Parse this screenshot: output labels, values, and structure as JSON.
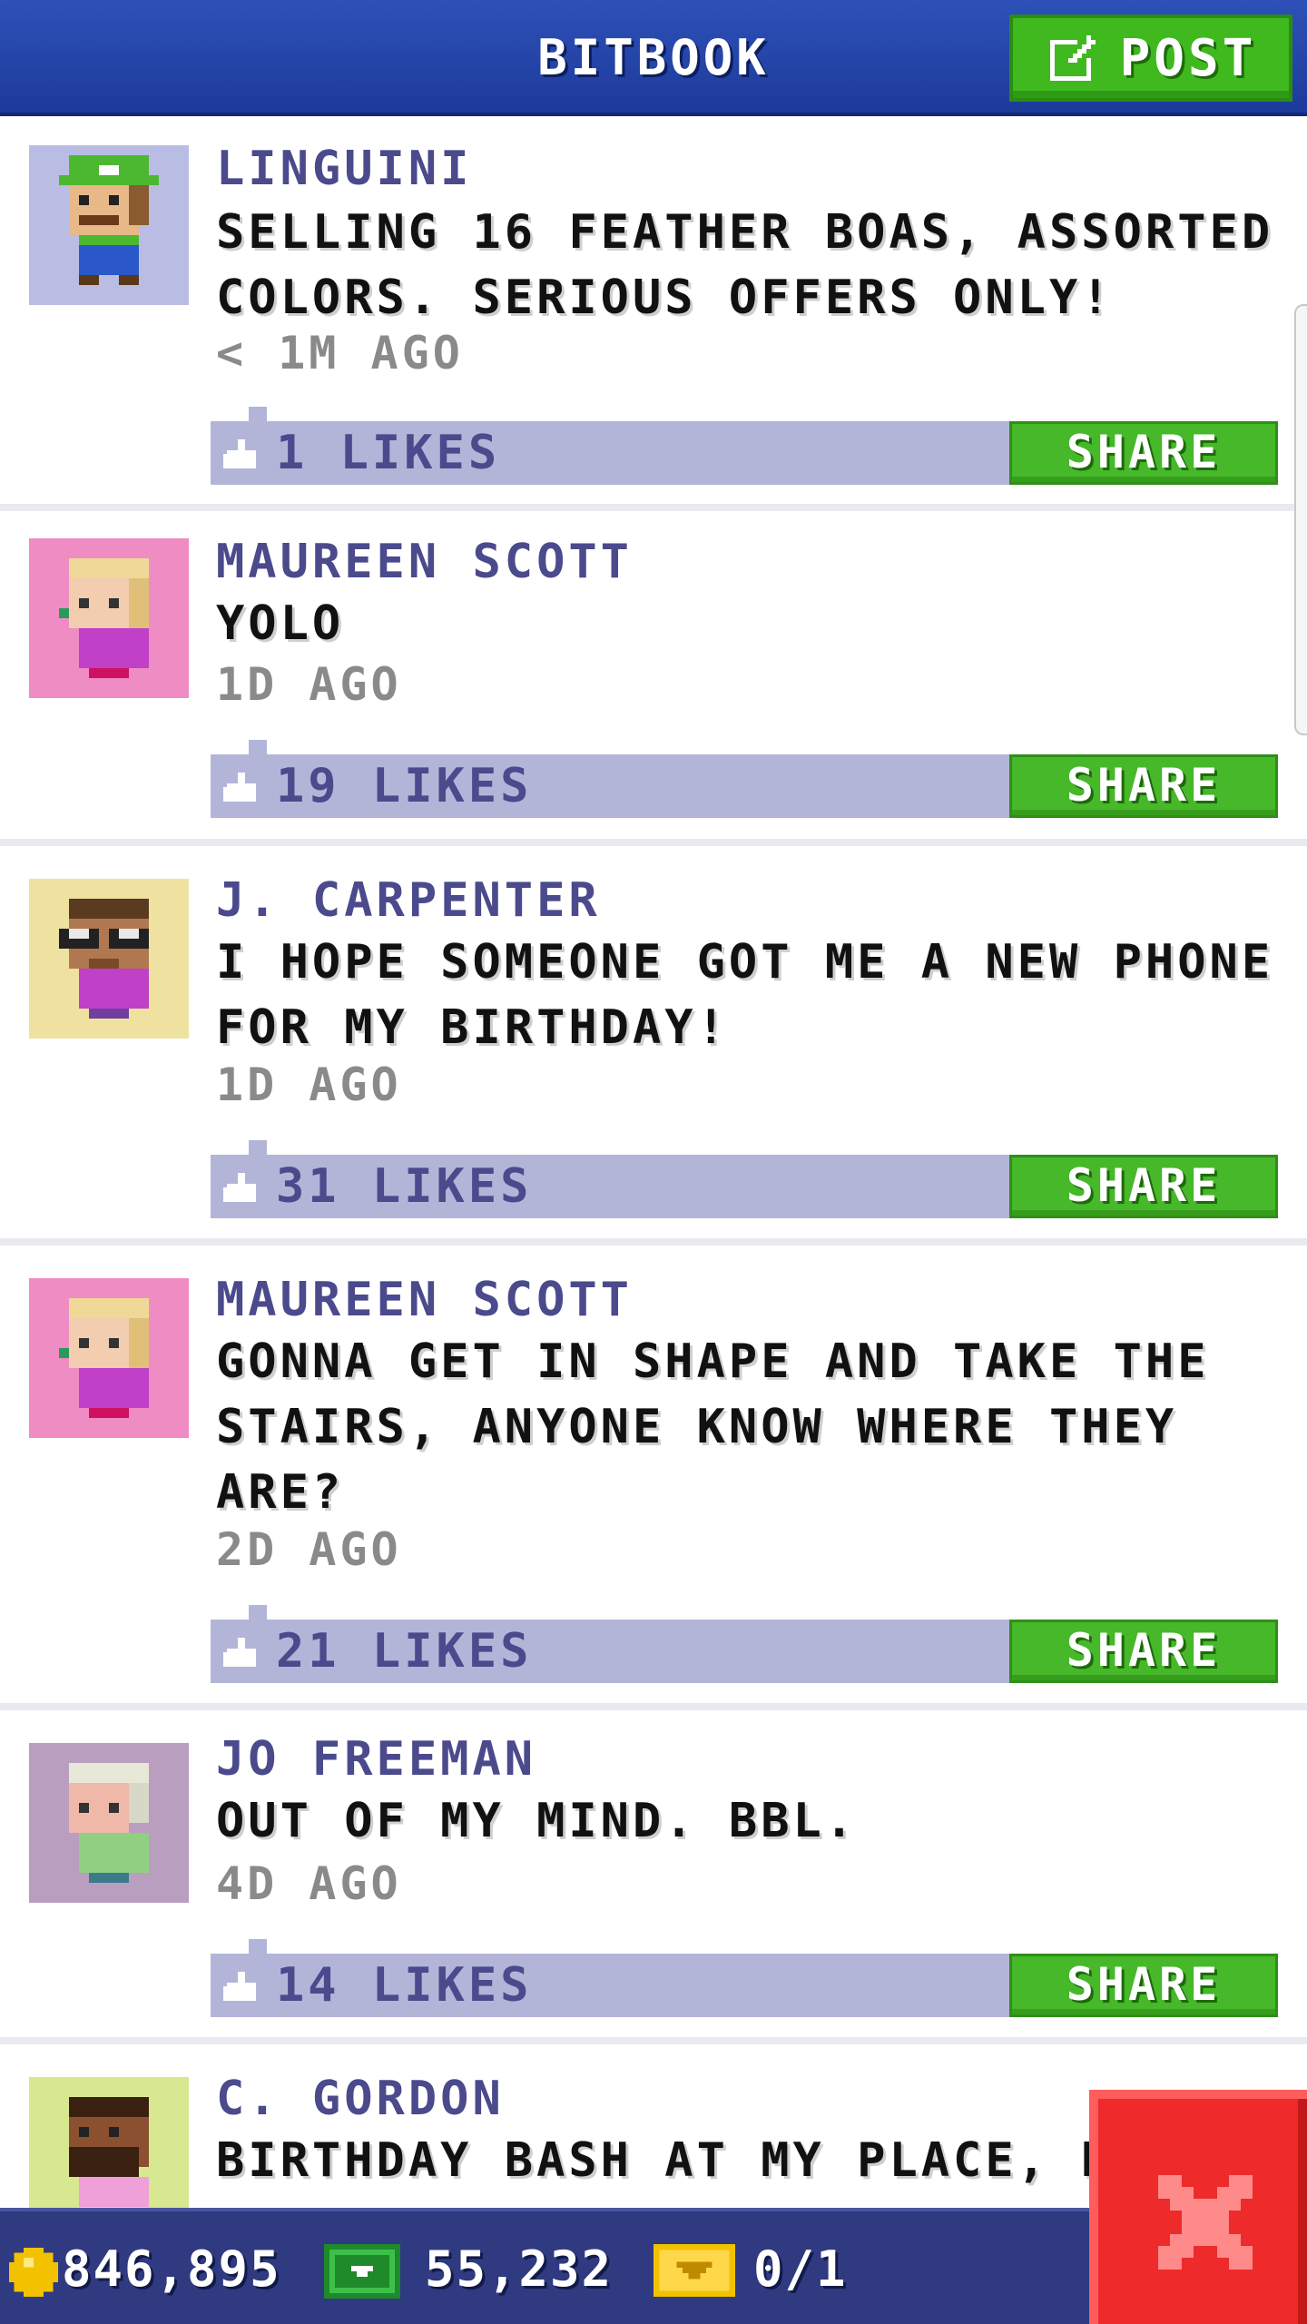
{
  "header": {
    "title": "BITBOOK",
    "post_label": "POST"
  },
  "posts": [
    {
      "name": "LINGUINI",
      "text": "SELLING 16 FEATHER BOAS, ASSORTED COLORS. SERIOUS OFFERS ONLY!",
      "time": "< 1M AGO",
      "likes": "1 LIKES",
      "share": "SHARE",
      "avatar_bg": "#b9bde3",
      "avatar_desc": "green-cap-mustache"
    },
    {
      "name": "MAUREEN SCOTT",
      "text": "YOLO",
      "time": "1D AGO",
      "likes": "19 LIKES",
      "share": "SHARE",
      "avatar_bg": "#f08cc4",
      "avatar_desc": "blonde-purple-shirt"
    },
    {
      "name": "J. CARPENTER",
      "text": "I HOPE SOMEONE GOT ME A NEW PHONE FOR MY BIRTHDAY!",
      "time": "1D AGO",
      "likes": "31 LIKES",
      "share": "SHARE",
      "avatar_bg": "#efe2a0",
      "avatar_desc": "glasses-purple-shirt"
    },
    {
      "name": "MAUREEN SCOTT",
      "text": "GONNA GET IN SHAPE AND TAKE THE STAIRS, ANYONE KNOW WHERE THEY ARE?",
      "time": "2D AGO",
      "likes": "21 LIKES",
      "share": "SHARE",
      "avatar_bg": "#f08cc4",
      "avatar_desc": "blonde-purple-shirt"
    },
    {
      "name": "JO FREEMAN",
      "text": "OUT OF MY MIND. BBL.",
      "time": "4D AGO",
      "likes": "14 LIKES",
      "share": "SHARE",
      "avatar_bg": "#b99ec0",
      "avatar_desc": "white-hair-green-shirt"
    },
    {
      "name": "C. GORDON",
      "text": "BIRTHDAY BASH AT MY PLACE, B",
      "avatar_bg": "#d8e890",
      "avatar_desc": "beard-pink-shirt"
    }
  ],
  "status": {
    "coins": "846,895",
    "bux": "55,232",
    "tickets": "0/1"
  },
  "colors": {
    "header_blue": "#2e51b8",
    "accent_green": "#3fb91e",
    "likes_bar": "#b3b5d8",
    "name_purple": "#4a4a8c",
    "bottom_bar": "#2f3a80",
    "close_red": "#ee2a2a"
  },
  "icons": {
    "post": "edit-icon",
    "like": "thumbs-up-icon",
    "coin": "coin-icon",
    "bux": "cash-icon",
    "ticket": "ticket-icon",
    "close": "close-icon"
  }
}
